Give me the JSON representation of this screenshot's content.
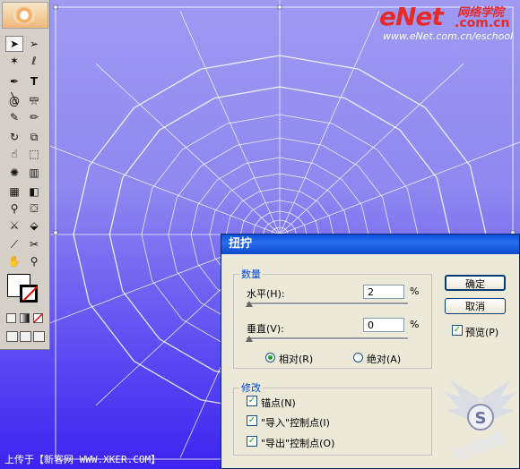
{
  "watermark": {
    "brand": "eNet",
    "brand_cn": "网络学院",
    "domain": ".com.cn",
    "url": "www.eNet.com.cn/eschool",
    "upload": "上传于【新客网 WWW.XKER.COM】",
    "badge_text": "岩月联盟"
  },
  "toolbox": {
    "tools": [
      "selection-tool",
      "direct-selection-tool",
      "magic-wand-tool",
      "lasso-tool",
      "pen-tool",
      "type-tool",
      "line-tool",
      "rectangle-tool",
      "spiral-tool",
      "star-tool",
      "paintbrush-tool",
      "pencil-tool",
      "rotate-tool",
      "scale-tool",
      "warp-tool",
      "free-transform-tool",
      "symbol-sprayer-tool",
      "column-graph-tool",
      "mesh-tool",
      "gradient-tool",
      "eyedropper-tool",
      "live-paint-tool",
      "slice-tool",
      "scissors-tool",
      "hand-tool",
      "zoom-tool"
    ]
  },
  "dialog": {
    "title": "扭拧",
    "amount_legend": "数量",
    "horizontal_label": "水平(H):",
    "horizontal_value": "2",
    "horizontal_unit": "%",
    "vertical_label": "垂直(V):",
    "vertical_value": "0",
    "vertical_unit": "%",
    "relative_label": "相对(R)",
    "absolute_label": "绝对(A)",
    "modify_legend": "修改",
    "anchor_label": "锚点(N)",
    "in_label": "\"导入\"控制点(I)",
    "out_label": "\"导出\"控制点(O)",
    "ok_label": "确定",
    "cancel_label": "取消",
    "preview_label": "预览(P)",
    "checkmark": "✓"
  }
}
